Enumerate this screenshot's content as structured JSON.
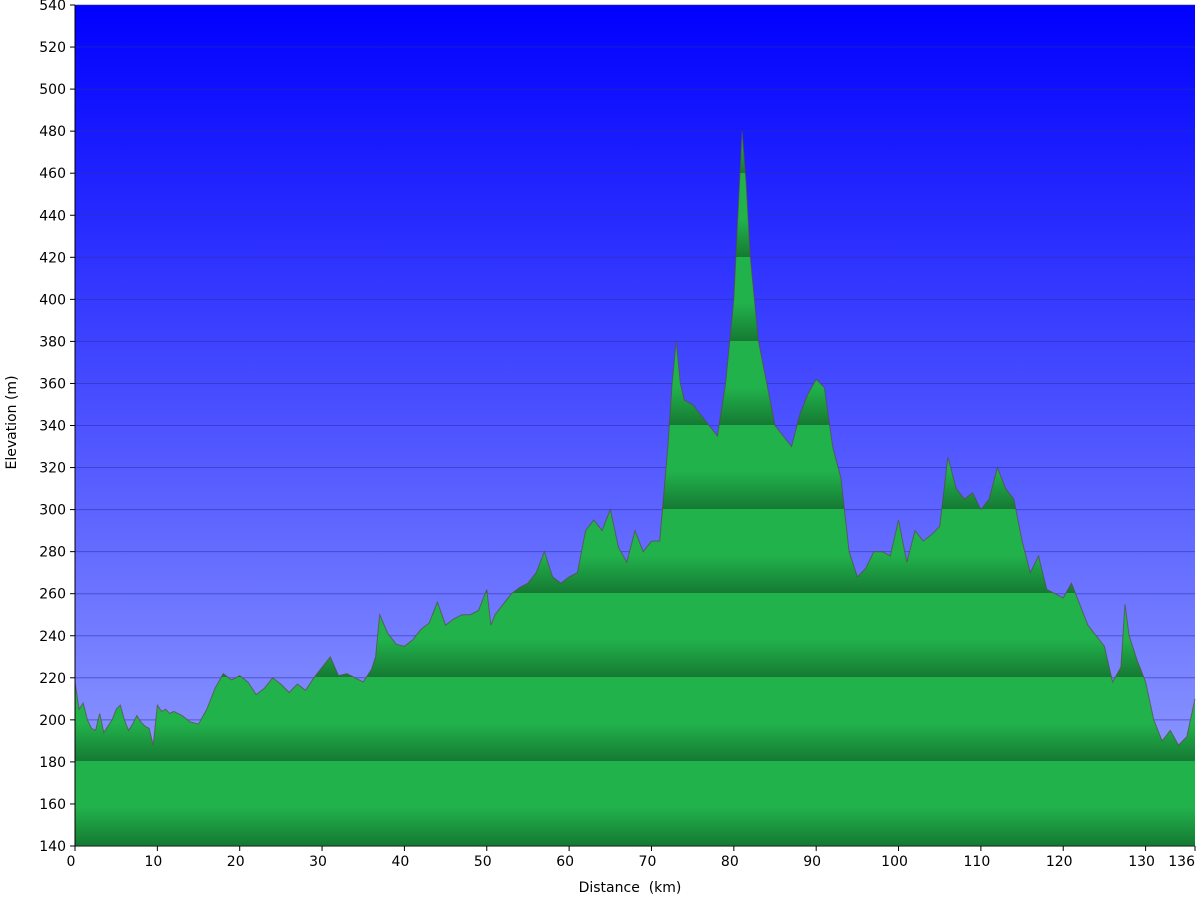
{
  "chart_data": {
    "type": "area",
    "title": "",
    "xlabel": "Distance  (km)",
    "ylabel": "Elevation (m)",
    "xlim": [
      0,
      136
    ],
    "ylim": [
      140,
      540
    ],
    "x_ticks": [
      {
        "value": 0,
        "label": "0"
      },
      {
        "value": 10,
        "label": "10"
      },
      {
        "value": 20,
        "label": "20"
      },
      {
        "value": 30,
        "label": "30"
      },
      {
        "value": 40,
        "label": "40"
      },
      {
        "value": 50,
        "label": "50"
      },
      {
        "value": 60,
        "label": "60"
      },
      {
        "value": 70,
        "label": "70"
      },
      {
        "value": 80,
        "label": "80"
      },
      {
        "value": 90,
        "label": "90"
      },
      {
        "value": 100,
        "label": "100"
      },
      {
        "value": 110,
        "label": "110"
      },
      {
        "value": 120,
        "label": "120"
      },
      {
        "value": 130,
        "label": "130"
      },
      {
        "value": 136,
        "label": "136"
      }
    ],
    "y_ticks": [
      140,
      160,
      180,
      200,
      220,
      240,
      260,
      280,
      300,
      320,
      340,
      360,
      380,
      400,
      420,
      440,
      460,
      480,
      500,
      520,
      540
    ],
    "grid": true,
    "colors": {
      "sky_top": "#0000ff",
      "sky_bottom": "#9aa6ff",
      "fill_light": "#22b24c",
      "fill_dark": "#157a33",
      "outline": "#5a4a3a",
      "grid": "#2b2fa8"
    },
    "series": [
      {
        "x": [
          0,
          0.5,
          1,
          1.5,
          2,
          2.5,
          3,
          3.5,
          4,
          4.5,
          5,
          5.5,
          6,
          6.5,
          7,
          7.5,
          8,
          8.5,
          9,
          9.5,
          10,
          10.5,
          11,
          11.5,
          12,
          13,
          14,
          15,
          16,
          17,
          18,
          19,
          20,
          21,
          22,
          23,
          24,
          25,
          26,
          27,
          28,
          29,
          30,
          31,
          32,
          33,
          34,
          35,
          36,
          36.5,
          37,
          38,
          39,
          40,
          41,
          42,
          43,
          44,
          45,
          46,
          47,
          48,
          49,
          50,
          50.5,
          51,
          52,
          53,
          54,
          55,
          56,
          57,
          58,
          59,
          60,
          61,
          62,
          63,
          64,
          65,
          66,
          67,
          68,
          69,
          70,
          71,
          72,
          72.5,
          73,
          73.5,
          74,
          75,
          76,
          77,
          78,
          79,
          80,
          80.5,
          81,
          81.5,
          82,
          83,
          84,
          85,
          86,
          87,
          88,
          89,
          90,
          91,
          92,
          93,
          94,
          95,
          96,
          97,
          98,
          99,
          100,
          101,
          102,
          103,
          104,
          105,
          106,
          107,
          108,
          109,
          110,
          111,
          112,
          113,
          114,
          115,
          116,
          117,
          118,
          119,
          120,
          121,
          122,
          123,
          124,
          125,
          126,
          127,
          127.5,
          128,
          129,
          130,
          131,
          132,
          133,
          134,
          135,
          136
        ],
        "y": [
          218,
          205,
          208,
          200,
          196,
          195,
          203,
          194,
          197,
          200,
          205,
          207,
          200,
          195,
          198,
          202,
          199,
          197,
          196,
          188,
          207,
          204,
          205,
          203,
          204,
          202,
          199,
          198,
          205,
          215,
          222,
          219,
          221,
          218,
          212,
          215,
          220,
          217,
          213,
          217,
          214,
          220,
          225,
          230,
          221,
          222,
          220,
          218,
          224,
          230,
          250,
          241,
          236,
          235,
          238,
          243,
          246,
          256,
          245,
          248,
          250,
          250,
          252,
          262,
          245,
          250,
          255,
          260,
          263,
          265,
          270,
          280,
          268,
          265,
          268,
          270,
          290,
          295,
          290,
          300,
          282,
          275,
          290,
          280,
          285,
          285,
          330,
          360,
          380,
          360,
          352,
          350,
          345,
          340,
          335,
          360,
          400,
          440,
          480,
          455,
          420,
          380,
          360,
          340,
          335,
          330,
          345,
          355,
          362,
          358,
          330,
          315,
          280,
          268,
          272,
          280,
          280,
          278,
          295,
          275,
          290,
          285,
          288,
          292,
          325,
          310,
          305,
          308,
          300,
          305,
          320,
          310,
          305,
          285,
          270,
          278,
          262,
          260,
          258,
          265,
          255,
          245,
          240,
          235,
          218,
          225,
          255,
          240,
          228,
          218,
          200,
          190,
          195,
          188,
          192,
          210
        ]
      }
    ]
  }
}
